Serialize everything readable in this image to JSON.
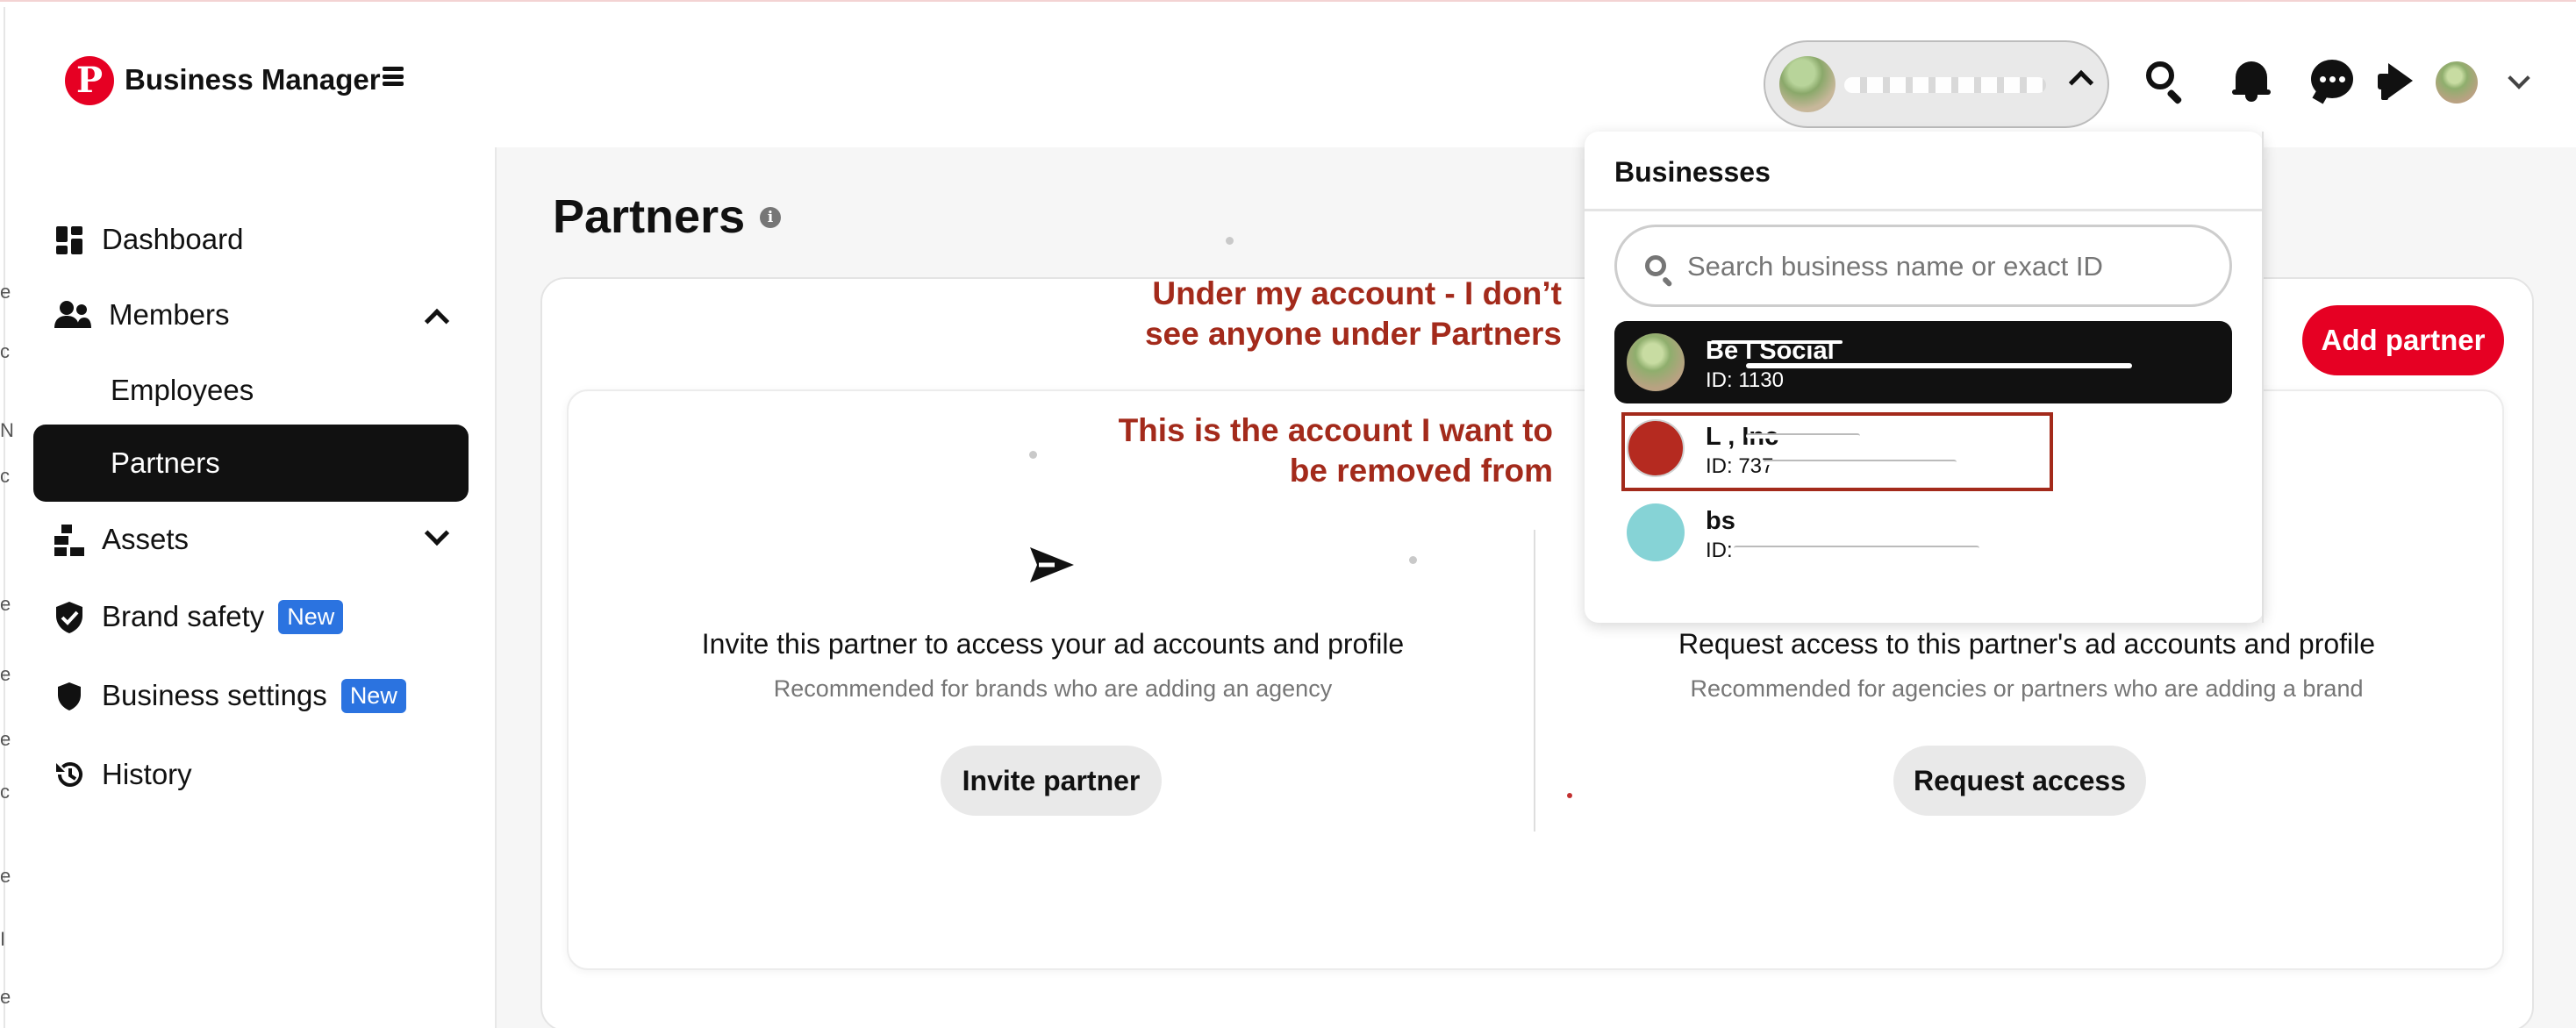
{
  "header": {
    "brand": "Business Manager",
    "logo_glyph": "P",
    "icons": [
      "search-icon",
      "bell-icon",
      "chat-icon",
      "megaphone-icon",
      "user-avatar",
      "chevron-down-icon"
    ]
  },
  "sidebar": {
    "items": [
      {
        "label": "Dashboard",
        "icon": "dashboard-icon"
      },
      {
        "label": "Members",
        "icon": "members-icon",
        "expanded": true
      },
      {
        "label": "Employees"
      },
      {
        "label": "Partners",
        "active": true
      },
      {
        "label": "Assets",
        "icon": "assets-icon",
        "expanded": false
      },
      {
        "label": "Brand safety",
        "icon": "shield-check-icon",
        "badge": "New"
      },
      {
        "label": "Business settings",
        "icon": "shield-icon",
        "badge": "New"
      },
      {
        "label": "History",
        "icon": "history-icon"
      }
    ]
  },
  "main": {
    "title": "Partners",
    "add_partner": "Add partner",
    "invite": {
      "title": "Invite this partner to access your ad accounts and profile",
      "subtitle": "Recommended for brands who are adding an agency",
      "button": "Invite partner"
    },
    "request": {
      "title": "Request access to this partner's ad accounts and profile",
      "subtitle": "Recommended for agencies or partners who are adding a brand",
      "button": "Request access"
    }
  },
  "dropdown": {
    "title": "Businesses",
    "search_placeholder": "Search business name or exact ID",
    "businesses": [
      {
        "name": "Be     l Social",
        "id": "ID: 1130",
        "selected": true
      },
      {
        "name": "L          , Inc",
        "id": "ID: 737"
      },
      {
        "name": "     bs",
        "id": "ID: "
      }
    ]
  },
  "annotations": {
    "top_line1": "Under my account - I don’t",
    "top_line2": "see anyone under Partners",
    "mid_line1": "This is the account I want to",
    "mid_line2": "be removed from"
  },
  "colors": {
    "brand_red": "#e60023",
    "annotation": "#a32a1b",
    "badge_blue": "#2b73e0"
  }
}
